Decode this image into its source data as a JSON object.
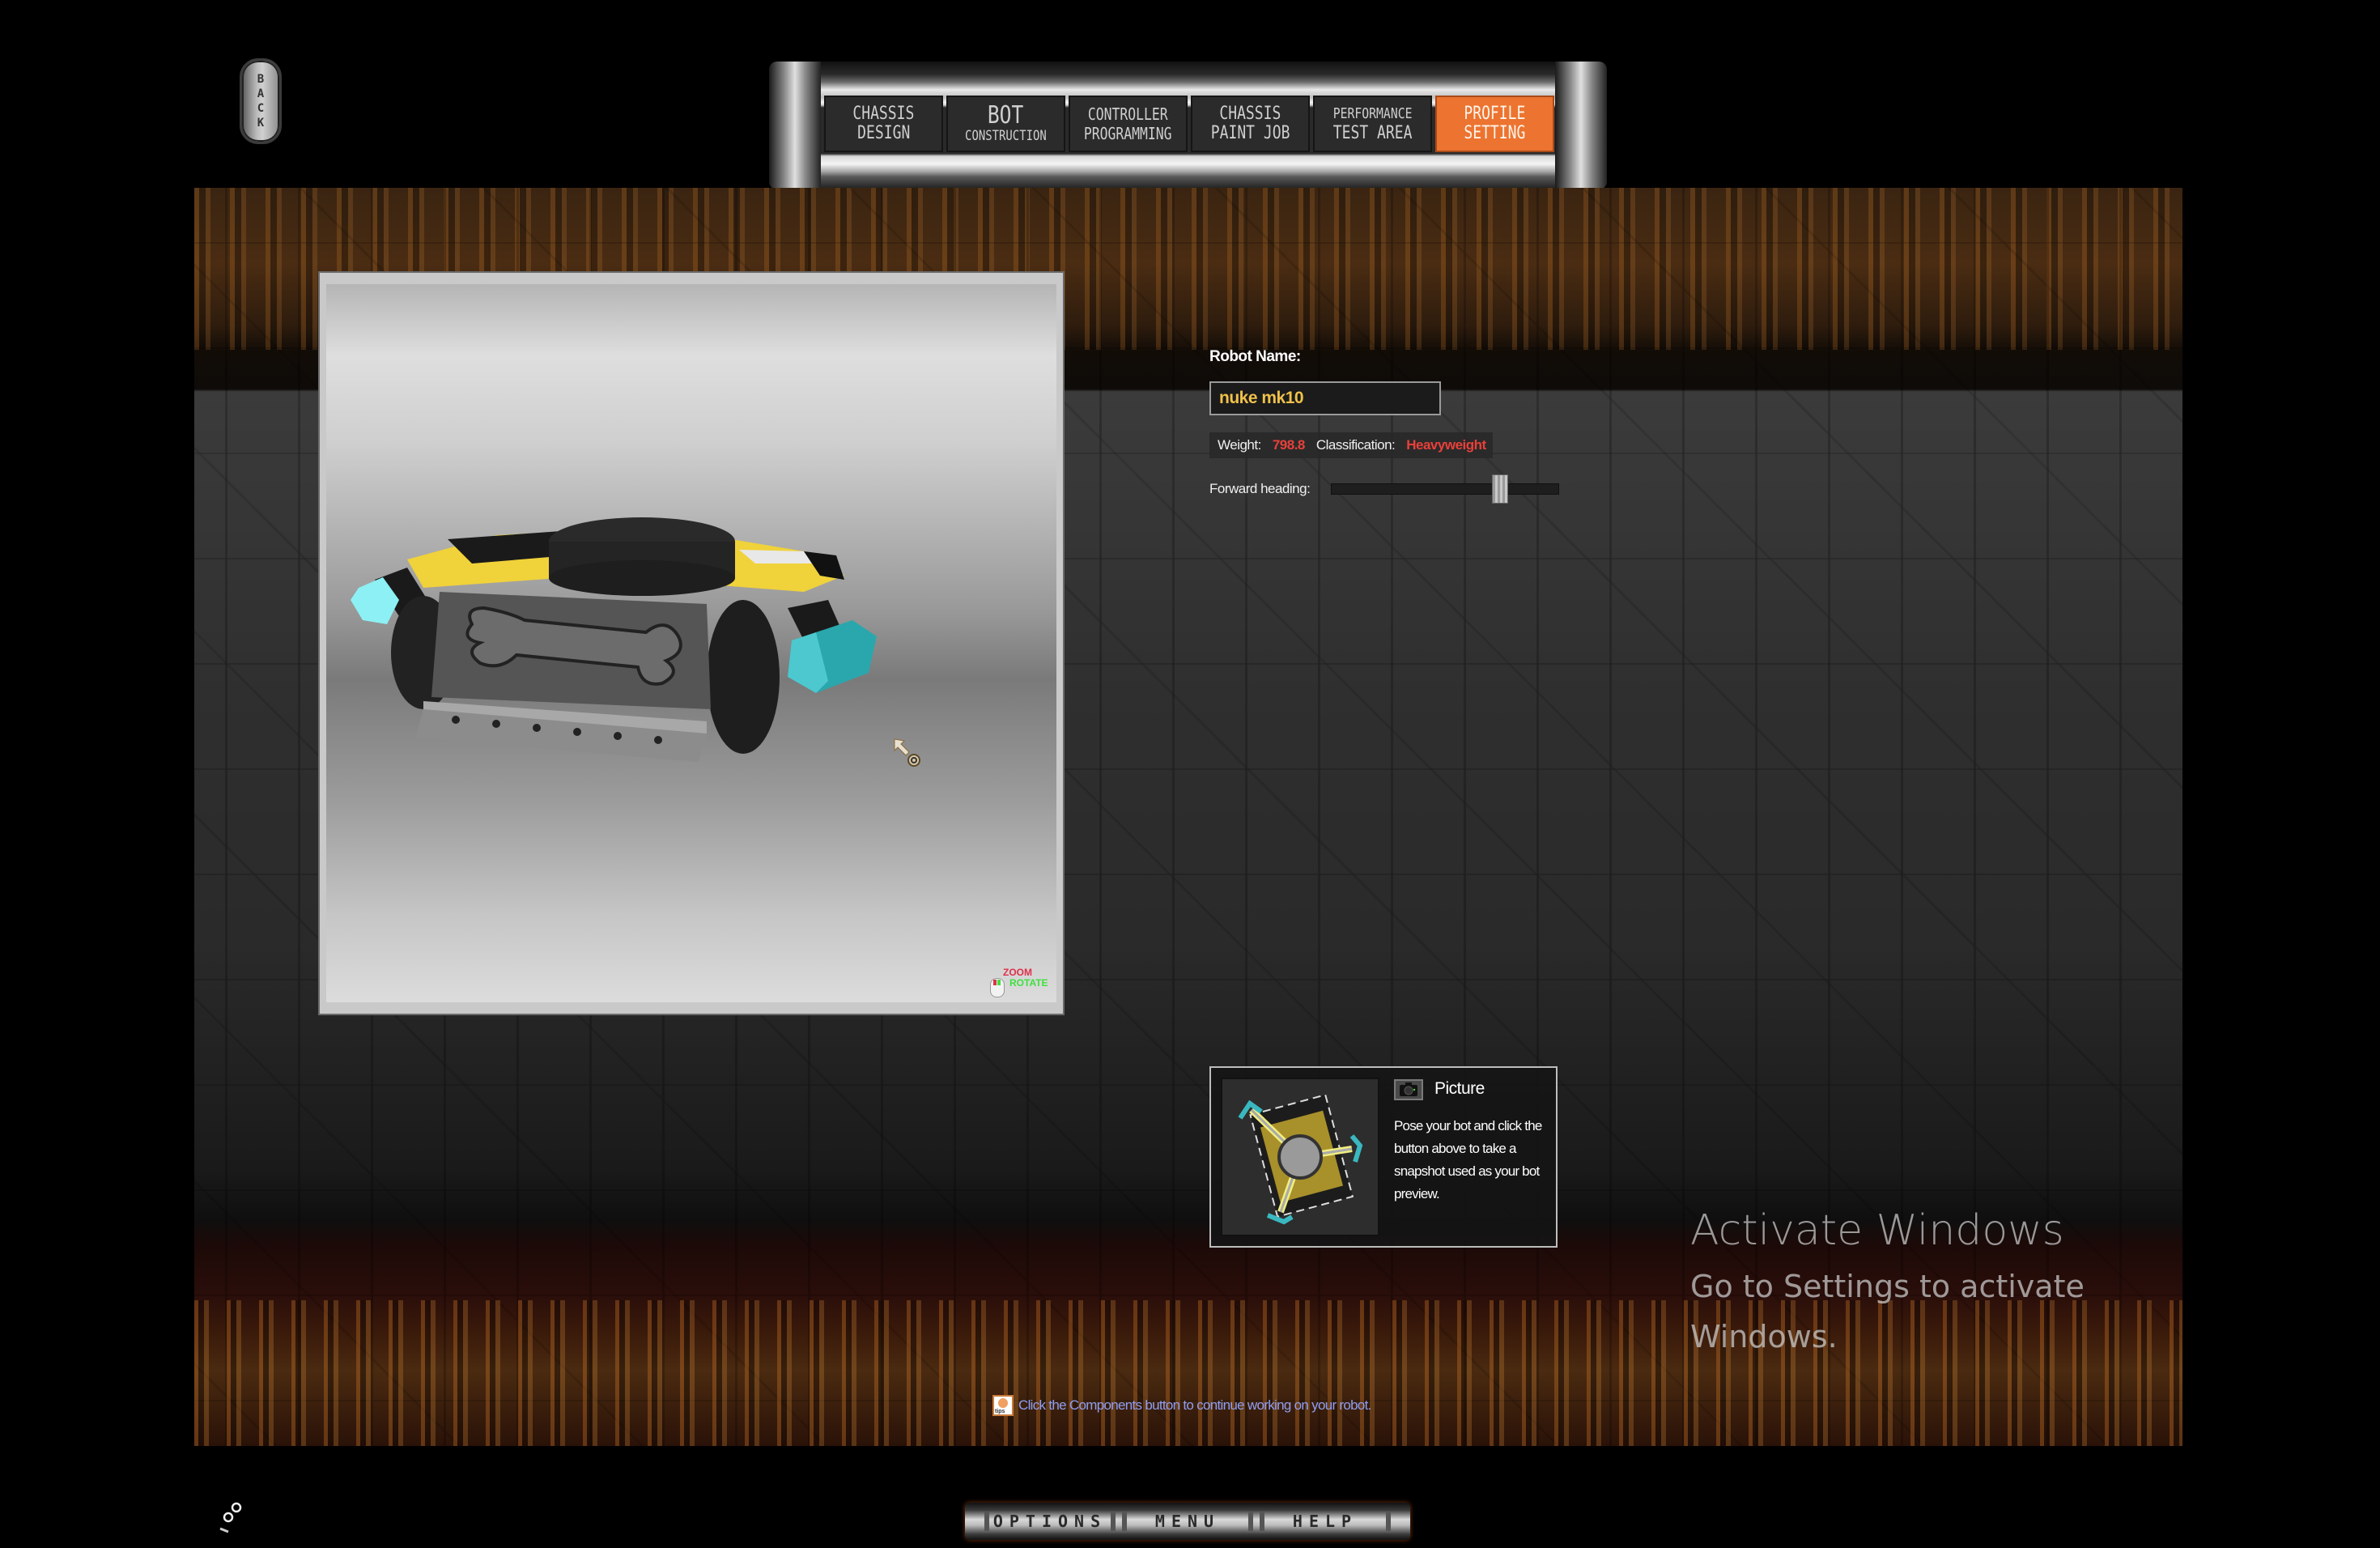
{
  "back_button": {
    "label": [
      "B",
      "A",
      "C",
      "K"
    ]
  },
  "nav": {
    "tabs": [
      {
        "line1": "CHASSIS",
        "line2": "DESIGN",
        "active": false
      },
      {
        "line1": "BOT",
        "line2": "CONSTRUCTION",
        "active": false
      },
      {
        "line1": "CONTROLLER",
        "line2": "PROGRAMMING",
        "active": false
      },
      {
        "line1": "CHASSIS",
        "line2": "PAINT JOB",
        "active": false
      },
      {
        "line1": "PERFORMANCE",
        "line2": "TEST AREA",
        "active": false
      },
      {
        "line1": "PROFILE",
        "line2": "SETTING",
        "active": true
      }
    ],
    "active_color": "#ec7430"
  },
  "viewport": {
    "hint_zoom": "ZOOM",
    "hint_rotate": "ROTATE"
  },
  "profile": {
    "robot_name_label": "Robot Name:",
    "robot_name_value": "nuke mk10",
    "weight_label": "Weight:",
    "weight_value": "798.8",
    "classification_label": "Classification:",
    "classification_value": "Heavyweight",
    "forward_heading_label": "Forward heading:",
    "forward_heading_fraction": 0.74,
    "value_color": "#e8403a",
    "name_color": "#f0c14a"
  },
  "picture": {
    "title": "Picture",
    "description": "Pose your bot and click the button above to take a snapshot used as your bot preview."
  },
  "tip": {
    "icon_label": "tips",
    "text": "Click the Components button to continue working on your robot."
  },
  "bottom_bar": {
    "options": "OPTIONS",
    "menu": "MENU",
    "help": "HELP"
  },
  "watermark": {
    "title": "Activate Windows",
    "subtitle": "Go to Settings to activate Windows."
  }
}
